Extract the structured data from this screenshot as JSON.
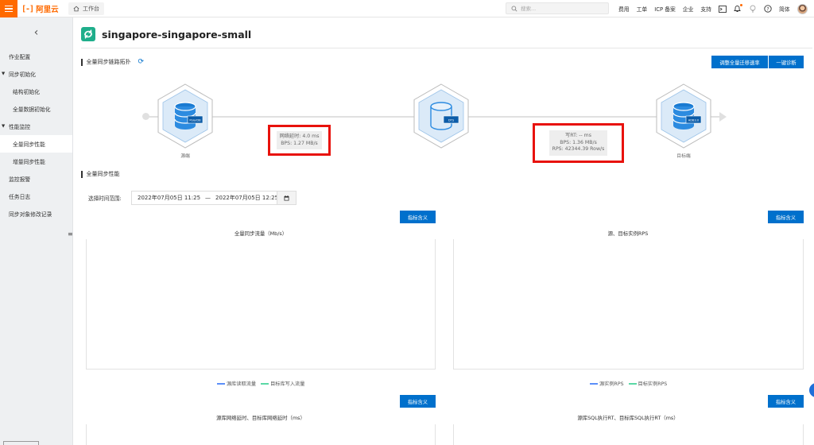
{
  "topbar": {
    "logo_text": "阿里云",
    "workbench_label": "工作台",
    "search_placeholder": "搜索...",
    "links": [
      "费用",
      "工单",
      "ICP 备案",
      "企业",
      "支持"
    ],
    "lang": "简体",
    "brand_color": "#ff6a00"
  },
  "sidebar": {
    "items": [
      {
        "label": "作业配置",
        "type": "item"
      },
      {
        "label": "同步初始化",
        "type": "group"
      },
      {
        "label": "结构初始化",
        "type": "sub"
      },
      {
        "label": "全量数据初始化",
        "type": "sub"
      },
      {
        "label": "性能监控",
        "type": "group"
      },
      {
        "label": "全量同步性能",
        "type": "sub",
        "active": true
      },
      {
        "label": "增量同步性能",
        "type": "sub"
      },
      {
        "label": "监控报警",
        "type": "item"
      },
      {
        "label": "任务日志",
        "type": "item"
      },
      {
        "label": "同步对象修改记录",
        "type": "item"
      }
    ]
  },
  "page": {
    "title": "singapore-singapore-small"
  },
  "topology": {
    "section_title": "全量同步链路拓扑",
    "adjust_button": "调整全量迁移速率",
    "diagnose_button": "一键诊断",
    "source_label": "源端",
    "target_label": "目标端",
    "source_badge": "PolarDB",
    "middle_badge": "DTS",
    "target_badge": "ADB3.0",
    "left_metric": {
      "latency": "网络延时: 4.0 ms",
      "bps": "BPS: 1.27 MB/s"
    },
    "right_metric": {
      "rt": "写RT: -- ms",
      "bps": "BPS: 1.36 MB/s",
      "rps": "RPS: 42344.39 Row/s"
    },
    "accent_color": "#0070cc",
    "highlight_color": "#e8120c"
  },
  "performance": {
    "section_title": "全量同步性能",
    "time_label": "选择时间范围:",
    "start": "2022年07月05日 11:25",
    "separator": "—",
    "end": "2022年07月05日 12:25",
    "metric_button": "指标含义",
    "charts": [
      {
        "title": "全量同步流量（Mb/s）",
        "legend": [
          "源库读取流量",
          "目标库写入流量"
        ]
      },
      {
        "title": "源、目标实例RPS",
        "legend": [
          "源实例RPS",
          "目标实例RPS"
        ]
      },
      {
        "title": "源库网络延时、目标库网络延时（ms）",
        "legend": []
      },
      {
        "title": "源库SQL执行RT、目标库SQL执行RT（ms）",
        "legend": []
      }
    ],
    "legend_colors": [
      "#5b8ff9",
      "#5ad8a6"
    ]
  }
}
